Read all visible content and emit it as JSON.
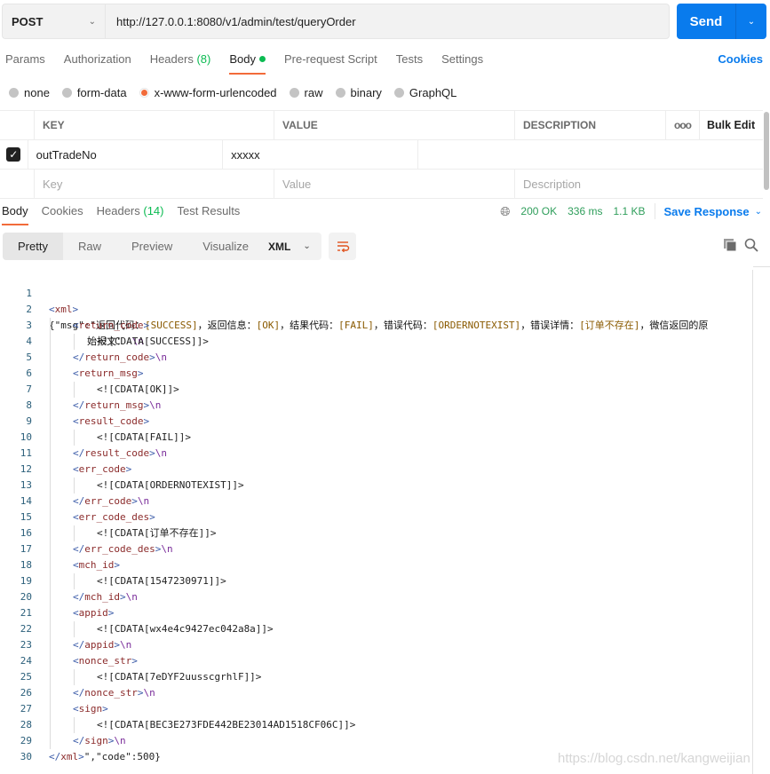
{
  "request": {
    "method": "POST",
    "url": "http://127.0.0.1:8080/v1/admin/test/queryOrder",
    "send_label": "Send"
  },
  "request_tabs": [
    {
      "label": "Params"
    },
    {
      "label": "Authorization"
    },
    {
      "label": "Headers",
      "count": "(8)"
    },
    {
      "label": "Body",
      "active": true,
      "indicator": "green-dot"
    },
    {
      "label": "Pre-request Script"
    },
    {
      "label": "Tests"
    },
    {
      "label": "Settings"
    }
  ],
  "cookies_label": "Cookies",
  "body_types": [
    {
      "label": "none"
    },
    {
      "label": "form-data"
    },
    {
      "label": "x-www-form-urlencoded",
      "selected": true
    },
    {
      "label": "raw"
    },
    {
      "label": "binary"
    },
    {
      "label": "GraphQL"
    }
  ],
  "params_table": {
    "headers": {
      "key": "KEY",
      "value": "VALUE",
      "description": "DESCRIPTION",
      "more": "ooo",
      "bulk_edit": "Bulk Edit"
    },
    "rows": [
      {
        "checked": true,
        "key": "outTradeNo",
        "value": "xxxxx",
        "description": ""
      }
    ],
    "placeholders": {
      "key": "Key",
      "value": "Value",
      "description": "Description"
    }
  },
  "response_tabs": [
    {
      "label": "Body",
      "active": true
    },
    {
      "label": "Cookies"
    },
    {
      "label": "Headers",
      "count": "(14)"
    },
    {
      "label": "Test Results"
    }
  ],
  "response_meta": {
    "status": "200 OK",
    "time": "336 ms",
    "size": "1.1 KB",
    "save_label": "Save Response"
  },
  "view_modes": [
    {
      "label": "Pretty",
      "active": true
    },
    {
      "label": "Raw"
    },
    {
      "label": "Preview"
    },
    {
      "label": "Visualize"
    }
  ],
  "language": "XML",
  "code_lines": {
    "l1a_open": "{\"msg\":\"",
    "l1_parts": [
      {
        "t": "cjk",
        "v": "返回代码："
      },
      {
        "t": "strval",
        "v": "[SUCCESS]"
      },
      {
        "t": "cjk",
        "v": "，返回信息："
      },
      {
        "t": "strval",
        "v": "[OK]"
      },
      {
        "t": "cjk",
        "v": "，结果代码："
      },
      {
        "t": "strval",
        "v": "[FAIL]"
      },
      {
        "t": "cjk",
        "v": "，错误代码："
      },
      {
        "t": "strval",
        "v": "[ORDERNOTEXIST]"
      },
      {
        "t": "cjk",
        "v": "，错误详情："
      },
      {
        "t": "strval",
        "v": "[订单不存在]"
      },
      {
        "t": "cjk",
        "v": "，微信返回的原"
      }
    ],
    "l1_wrap_cjk": "始报文：",
    "l1_wrap_nl": "\\n",
    "lines": [
      {
        "n": "2",
        "indent": 0,
        "kind": "open",
        "tag": "xml"
      },
      {
        "n": "3",
        "indent": 1,
        "kind": "open",
        "tag": "return_code"
      },
      {
        "n": "4",
        "indent": 2,
        "kind": "cdata",
        "value": "<![CDATA[SUCCESS]]>"
      },
      {
        "n": "5",
        "indent": 1,
        "kind": "close",
        "tag": "return_code"
      },
      {
        "n": "6",
        "indent": 1,
        "kind": "open",
        "tag": "return_msg"
      },
      {
        "n": "7",
        "indent": 2,
        "kind": "cdata",
        "value": "<![CDATA[OK]]>"
      },
      {
        "n": "8",
        "indent": 1,
        "kind": "close",
        "tag": "return_msg"
      },
      {
        "n": "9",
        "indent": 1,
        "kind": "open",
        "tag": "result_code"
      },
      {
        "n": "10",
        "indent": 2,
        "kind": "cdata",
        "value": "<![CDATA[FAIL]]>"
      },
      {
        "n": "11",
        "indent": 1,
        "kind": "close",
        "tag": "result_code"
      },
      {
        "n": "12",
        "indent": 1,
        "kind": "open",
        "tag": "err_code"
      },
      {
        "n": "13",
        "indent": 2,
        "kind": "cdata",
        "value": "<![CDATA[ORDERNOTEXIST]]>"
      },
      {
        "n": "14",
        "indent": 1,
        "kind": "close",
        "tag": "err_code"
      },
      {
        "n": "15",
        "indent": 1,
        "kind": "open",
        "tag": "err_code_des"
      },
      {
        "n": "16",
        "indent": 2,
        "kind": "cdata",
        "value": "<![CDATA[订单不存在]]>"
      },
      {
        "n": "17",
        "indent": 1,
        "kind": "close",
        "tag": "err_code_des"
      },
      {
        "n": "18",
        "indent": 1,
        "kind": "open",
        "tag": "mch_id"
      },
      {
        "n": "19",
        "indent": 2,
        "kind": "cdata",
        "value": "<![CDATA[1547230971]]>"
      },
      {
        "n": "20",
        "indent": 1,
        "kind": "close",
        "tag": "mch_id"
      },
      {
        "n": "21",
        "indent": 1,
        "kind": "open",
        "tag": "appid"
      },
      {
        "n": "22",
        "indent": 2,
        "kind": "cdata",
        "value": "<![CDATA[wx4e4c9427ec042a8a]]>"
      },
      {
        "n": "23",
        "indent": 1,
        "kind": "close",
        "tag": "appid"
      },
      {
        "n": "24",
        "indent": 1,
        "kind": "open",
        "tag": "nonce_str"
      },
      {
        "n": "25",
        "indent": 2,
        "kind": "cdata",
        "value": "<![CDATA[7eDYF2uusscgrhlF]]>"
      },
      {
        "n": "26",
        "indent": 1,
        "kind": "close",
        "tag": "nonce_str"
      },
      {
        "n": "27",
        "indent": 1,
        "kind": "open",
        "tag": "sign"
      },
      {
        "n": "28",
        "indent": 2,
        "kind": "cdata",
        "value": "<![CDATA[BEC3E273FDE442BE23014AD1518CF06C]]>"
      },
      {
        "n": "29",
        "indent": 1,
        "kind": "close",
        "tag": "sign"
      },
      {
        "n": "30",
        "indent": 0,
        "kind": "final",
        "tag": "xml",
        "tail": "\",\"code\":500}"
      }
    ],
    "newline_escape": "\\n"
  },
  "watermark": "https://blog.csdn.net/kangweijian",
  "colors": {
    "accent_orange": "#f26b3a",
    "brand_blue": "#097bed",
    "status_green": "#2f9e5b",
    "count_green": "#0cbb52"
  }
}
